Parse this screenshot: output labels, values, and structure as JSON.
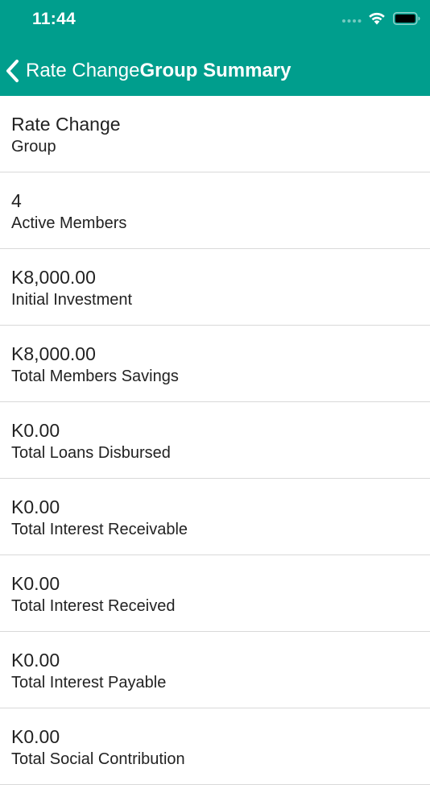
{
  "status_bar": {
    "time": "11:44"
  },
  "colors": {
    "header_bg": "#009e8d",
    "header_text": "#ffffff",
    "divider": "#d9d9d9",
    "text": "#222222"
  },
  "nav": {
    "back_icon": "chevron-left-icon",
    "back_label": "Rate Change",
    "title": "Group Summary"
  },
  "summary": [
    {
      "value": "Rate Change",
      "label": "Group"
    },
    {
      "value": "4",
      "label": "Active Members"
    },
    {
      "value": "K8,000.00",
      "label": "Initial Investment"
    },
    {
      "value": "K8,000.00",
      "label": "Total Members Savings"
    },
    {
      "value": "K0.00",
      "label": "Total Loans Disbursed"
    },
    {
      "value": "K0.00",
      "label": "Total Interest Receivable"
    },
    {
      "value": "K0.00",
      "label": "Total Interest Received"
    },
    {
      "value": "K0.00",
      "label": "Total Interest Payable"
    },
    {
      "value": "K0.00",
      "label": "Total Social Contribution"
    }
  ]
}
